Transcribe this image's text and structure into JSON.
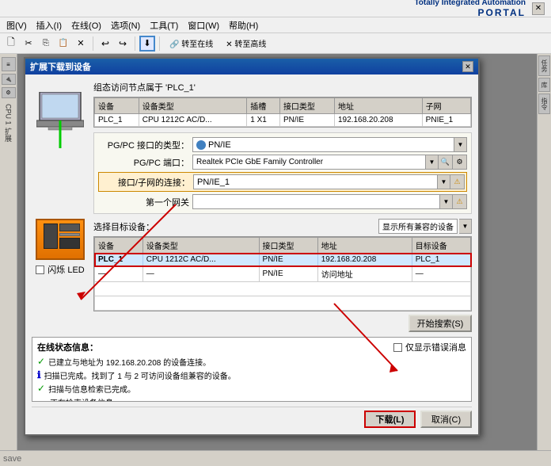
{
  "tia": {
    "brand_title": "Totally Integrated Automation",
    "brand_portal": "PORTAL"
  },
  "menu": {
    "items": [
      "图(V)",
      "插入(I)",
      "在线(O)",
      "选项(N)",
      "工具(T)",
      "窗口(W)",
      "帮助(H)"
    ]
  },
  "dialog": {
    "title": "扩展下载到设备",
    "group_label": "组态访问节点属于 'PLC_1'",
    "top_table": {
      "headers": [
        "设备",
        "设备类型",
        "插槽",
        "接口类型",
        "地址",
        "子网"
      ],
      "rows": [
        [
          "PLC_1",
          "CPU 1212C AC/D...",
          "1 X1",
          "PN/IE",
          "192.168.20.208",
          "PNIE_1"
        ]
      ]
    },
    "form": {
      "pgpc_interface_label": "PG/PC 接口的类型：",
      "pgpc_interface_value": "▣ PN/IE",
      "pgpc_port_label": "PG/PC 端口：",
      "pgpc_port_value": "Realtek PCIe GbE Family Controller",
      "subnet_label": "接口/子网的连接：",
      "subnet_value": "PN/IE_1",
      "gateway_label": "第一个网关"
    },
    "bottom_section": {
      "label": "选择目标设备：",
      "display_label": "显示所有兼容的设备",
      "table": {
        "headers": [
          "设备",
          "设备类型",
          "接口类型",
          "地址",
          "目标设备"
        ],
        "rows": [
          [
            "PLC_1",
            "CPU 1212C AC/D...",
            "PN/IE",
            "192.168.20.208",
            "PLC_1"
          ],
          [
            "—",
            "—",
            "PN/IE",
            "访问地址",
            "—"
          ]
        ]
      }
    },
    "device_label": "闪烁 LED",
    "search_btn": "开始搜索(S)",
    "status_section": {
      "title": "在线状态信息：",
      "checkbox_label": "仅显示错误消息",
      "items": [
        {
          "icon": "✓",
          "type": "green",
          "text": "已建立与地址为 192.168.20.208 的设备连接。"
        },
        {
          "icon": "ℹ",
          "type": "blue",
          "text": "扫描已完成。找到了 1 与 2 可访问设备组兼容的设备。"
        },
        {
          "icon": "✓",
          "type": "check",
          "text": "扫描与信息检索已完成。"
        },
        {
          "icon": "→",
          "type": "red",
          "text": "正在检索设备信息..."
        }
      ]
    },
    "buttons": {
      "download": "下载(L)",
      "cancel": "取消(C)"
    }
  }
}
